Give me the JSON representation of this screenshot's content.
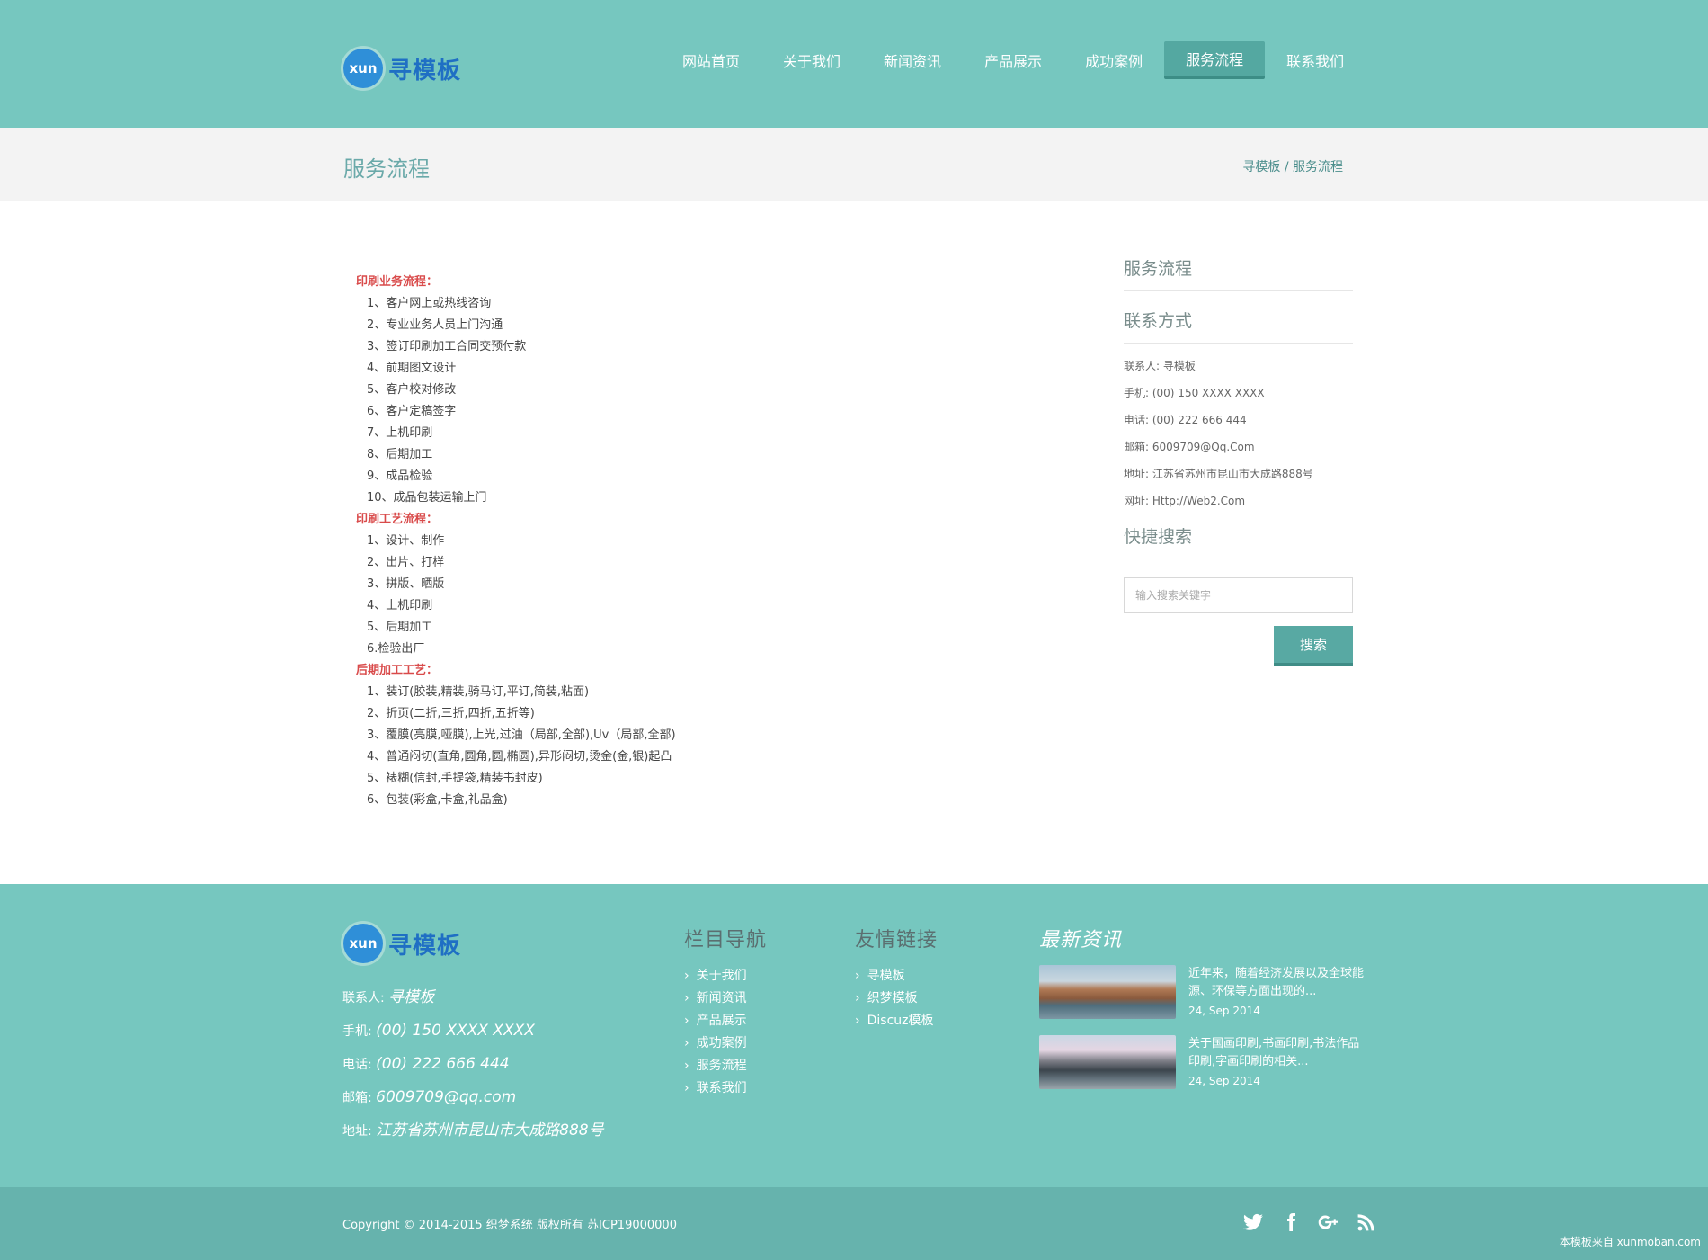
{
  "brand": {
    "badge": "xun",
    "name": "寻模板"
  },
  "nav": [
    {
      "label": "网站首页",
      "active": false
    },
    {
      "label": "关于我们",
      "active": false
    },
    {
      "label": "新闻资讯",
      "active": false
    },
    {
      "label": "产品展示",
      "active": false
    },
    {
      "label": "成功案例",
      "active": false
    },
    {
      "label": "服务流程",
      "active": true
    },
    {
      "label": "联系我们",
      "active": false
    }
  ],
  "page": {
    "title": "服务流程",
    "breadcrumb": {
      "home": "寻模板",
      "sep": " / ",
      "current": "服务流程"
    }
  },
  "content": {
    "sections": [
      {
        "title": "印刷业务流程：",
        "items": [
          "1、客户网上或热线咨询",
          "2、专业业务人员上门沟通",
          "3、签订印刷加工合同交预付款",
          "4、前期图文设计",
          "5、客户校对修改",
          "6、客户定稿签字",
          "7、上机印刷",
          "8、后期加工",
          "9、成品检验",
          "10、成品包装运输上门"
        ]
      },
      {
        "title": "印刷工艺流程：",
        "items": [
          "1、设计、制作",
          "2、出片、打样",
          "3、拼版、晒版",
          "4、上机印刷",
          "5、后期加工",
          "6.检验出厂"
        ]
      },
      {
        "title": "后期加工工艺：",
        "items": [
          "1、装订(胶装,精装,骑马订,平订,简装,粘面)",
          "2、折页(二折,三折,四折,五折等)",
          "3、覆膜(亮膜,哑膜),上光,过油（局部,全部),Uv（局部,全部)",
          "4、普通闷切(直角,圆角,圆,椭圆),异形闷切,烫金(金,银)起凸",
          "5、裱糊(信封,手提袋,精装书封皮)",
          "6、包装(彩盒,卡盒,礼品盒)"
        ]
      }
    ]
  },
  "sidebar": {
    "heading_service": "服务流程",
    "heading_contact": "联系方式",
    "contact": [
      "联系人: 寻模板",
      "手机: (00) 150 XXXX XXXX",
      "电话: (00) 222 666 444",
      "邮箱: 6009709@Qq.Com",
      "地址: 江苏省苏州市昆山市大成路888号",
      "网址: Http://Web2.Com"
    ],
    "heading_search": "快捷搜索",
    "search_placeholder": "输入搜索关键字",
    "search_button": "搜索"
  },
  "footer": {
    "contact": [
      {
        "label": "联系人: ",
        "value": "寻模板"
      },
      {
        "label": "手机: ",
        "value": "(00) 150 XXXX XXXX"
      },
      {
        "label": "电话: ",
        "value": "(00) 222 666 444"
      },
      {
        "label": "邮箱: ",
        "value": "6009709@qq.com"
      },
      {
        "label": "地址: ",
        "value": "江苏省苏州市昆山市大成路888号"
      }
    ],
    "nav_title": "栏目导航",
    "nav_items": [
      "关于我们",
      "新闻资讯",
      "产品展示",
      "成功案例",
      "服务流程",
      "联系我们"
    ],
    "links_title": "友情链接",
    "link_items": [
      "寻模板",
      "织梦模板",
      "Discuz模板"
    ],
    "news_title": "最新资讯",
    "news": [
      {
        "title": "近年来，随着经济发展以及全球能源、环保等方面出现的...",
        "date": "24, Sep 2014"
      },
      {
        "title": "关于国画印刷,书画印刷,书法作品印刷,字画印刷的相关...",
        "date": "24, Sep 2014"
      }
    ]
  },
  "bottom": {
    "copyright": "Copyright © 2014-2015 织梦系统 版权所有 苏ICP19000000",
    "social": [
      "twitter-icon",
      "facebook-icon",
      "google-plus-icon",
      "rss-icon"
    ],
    "watermark": "本模板来自 xunmoban.com"
  },
  "colors": {
    "header_bg": "#76c7bf",
    "accent_dark": "#54a8a1",
    "section_title": "#d94b4b",
    "bottom_bg": "#66b3ad"
  }
}
